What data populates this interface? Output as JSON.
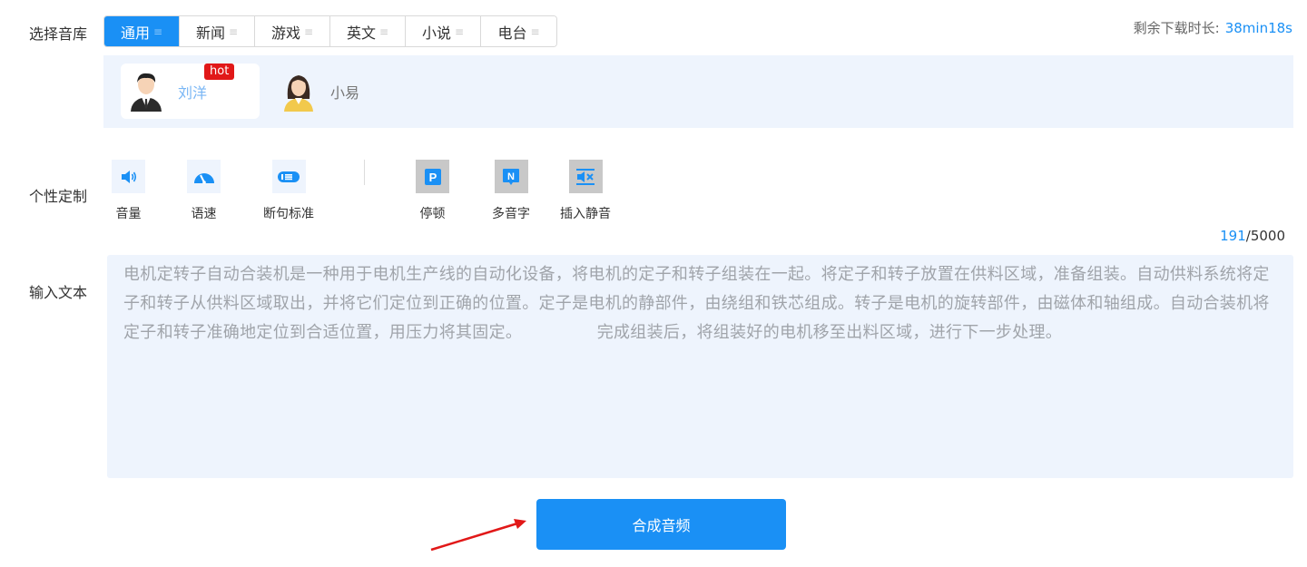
{
  "labels": {
    "library": "选择音库",
    "custom": "个性定制",
    "input": "输入文本"
  },
  "tabs": [
    {
      "label": "通用",
      "active": true
    },
    {
      "label": "新闻"
    },
    {
      "label": "游戏"
    },
    {
      "label": "英文"
    },
    {
      "label": "小说"
    },
    {
      "label": "电台"
    }
  ],
  "tab_menu_glyph": "≡",
  "remaining": {
    "label": "剩余下载时长:",
    "value": "38min18s"
  },
  "voices": [
    {
      "name": "刘洋",
      "badge": "hot",
      "icon": "male-avatar-icon",
      "selected": true
    },
    {
      "name": "小易",
      "icon": "female-avatar-icon",
      "selected": false
    }
  ],
  "tools": [
    {
      "label": "音量",
      "icon": "volume-icon"
    },
    {
      "label": "语速",
      "icon": "speed-gauge-icon"
    },
    {
      "label": "断句标准",
      "icon": "sentence-break-icon"
    },
    {
      "label": "停顿",
      "icon": "pause-p-icon"
    },
    {
      "label": "多音字",
      "icon": "polyphone-n-icon"
    },
    {
      "label": "插入静音",
      "icon": "insert-silence-icon"
    }
  ],
  "counter": {
    "current": "191",
    "max": "/5000"
  },
  "text_content": "电机定转子自动合装机是一种用于电机生产线的自动化设备，将电机的定子和转子组装在一起。将定子和转子放置在供料区域，准备组装。自动供料系统将定子和转子从供料区域取出，并将它们定位到正确的位置。定子是电机的静部件，由绕组和铁芯组成。转子是电机的旋转部件，由磁体和轴组成。自动合装机将定子和转子准确地定位到合适位置，用压力将其固定。　　　　　完成组装后，将组装好的电机移至出料区域，进行下一步处理。",
  "submit_label": "合成音频",
  "colors": {
    "accent": "#1a90f5",
    "panel": "#eef4fd",
    "hot": "#e11818",
    "annotation_arrow": "#e11818"
  }
}
